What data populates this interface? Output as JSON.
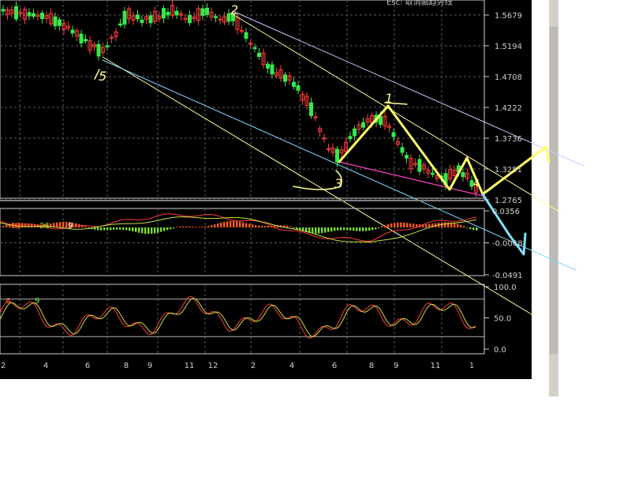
{
  "header": {
    "caption": "Esc: 取消画趋势线"
  },
  "chart_data": [
    {
      "type": "candlestick",
      "panel": "price",
      "y_ticks": [
        "1.5679",
        "1.5194",
        "1.4708",
        "1.4222",
        "1.3736",
        "1.3251",
        "1.2765"
      ],
      "ylim": [
        1.2765,
        1.5679
      ],
      "grid": true,
      "trend": "descending channel",
      "annotations": [
        "1",
        "2",
        "3",
        "4",
        "5"
      ]
    },
    {
      "type": "bar",
      "panel": "macd",
      "y_ticks": [
        "0.0356",
        "-0.0068",
        "-0.0491"
      ],
      "params": [
        "12",
        "26",
        "9"
      ],
      "colors": {
        "positive": "#ff5a1e",
        "negative": "#7ddc2e",
        "dif": "#ff3b3b",
        "dea": "#c8e040"
      }
    },
    {
      "type": "line",
      "panel": "kdj",
      "y_ticks": [
        "100.0",
        "50.0",
        "0.0"
      ],
      "ylim": [
        0,
        100
      ],
      "params": [
        "6",
        "9"
      ],
      "colors": {
        "k": "#ff3b3b",
        "d": "#c8e040"
      }
    }
  ],
  "x_axis": {
    "labels": [
      "2",
      "4",
      "6",
      "8",
      "9",
      "11",
      "12",
      "2",
      "4",
      "6",
      "8",
      "9",
      "11",
      "1"
    ]
  }
}
